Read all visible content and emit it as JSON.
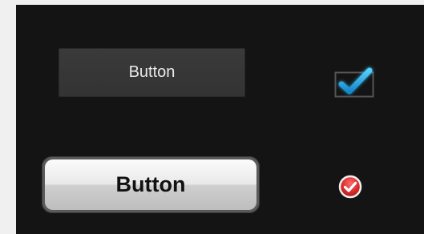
{
  "controls": {
    "flat_button_label": "Button",
    "glossy_button_label": "Button",
    "checkbox_checked": true,
    "round_check_checked": true
  },
  "colors": {
    "panel_background": "#141414",
    "outer_background": "#f0f0f0",
    "checkmark_blue": "#27a8e0",
    "round_check_red": "#d32d2d"
  }
}
